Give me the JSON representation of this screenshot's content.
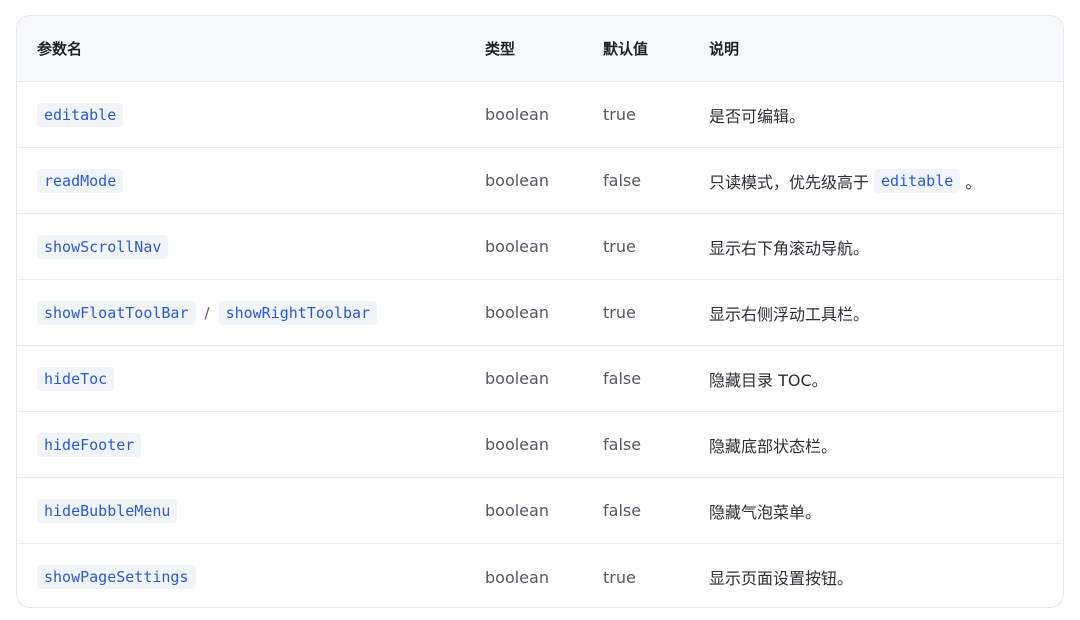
{
  "table": {
    "headers": {
      "name": "参数名",
      "type": "类型",
      "default": "默认值",
      "desc": "说明"
    },
    "rows": [
      {
        "name": "editable",
        "type": "boolean",
        "default": "true",
        "desc": "是否可编辑。"
      },
      {
        "name": "readMode",
        "type": "boolean",
        "default": "false",
        "desc_prefix": "只读模式，优先级高于",
        "desc_code": "editable",
        "desc_suffix": "。"
      },
      {
        "name": "showScrollNav",
        "type": "boolean",
        "default": "true",
        "desc": "显示右下角滚动导航。"
      },
      {
        "name": "showFloatToolBar",
        "name_sep": "/",
        "name_alt": "showRightToolbar",
        "type": "boolean",
        "default": "true",
        "desc": "显示右侧浮动工具栏。"
      },
      {
        "name": "hideToc",
        "type": "boolean",
        "default": "false",
        "desc": "隐藏目录 TOC。"
      },
      {
        "name": "hideFooter",
        "type": "boolean",
        "default": "false",
        "desc": "隐藏底部状态栏。"
      },
      {
        "name": "hideBubbleMenu",
        "type": "boolean",
        "default": "false",
        "desc": "隐藏气泡菜单。"
      },
      {
        "name": "showPageSettings",
        "type": "boolean",
        "default": "true",
        "desc": "显示页面设置按钮。"
      }
    ]
  }
}
